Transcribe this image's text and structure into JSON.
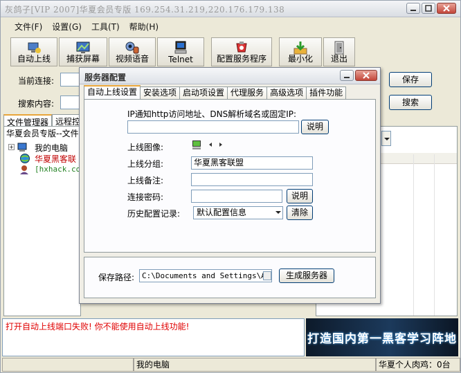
{
  "window": {
    "title": "灰鸽子[VIP 2007]华夏会员专版  169.254.31.219,220.176.179.138"
  },
  "menu": [
    "文件(F)",
    "设置(G)",
    "工具(T)",
    "帮助(H)"
  ],
  "toolbar": {
    "buttons": [
      "自动上线",
      "捕获屏幕",
      "视频语音",
      "Telnet",
      "配置服务程序",
      "最小化",
      "退出"
    ]
  },
  "connection": {
    "current_label": "当前连接:",
    "search_label": "搜索内容:",
    "save_button": "保存",
    "search_button": "搜索"
  },
  "main_tabs": [
    "文件管理器",
    "远程控"
  ],
  "tree": {
    "header": "华夏会员专版--文件",
    "items": [
      "我的电脑",
      "华夏黑客联",
      "[hxhack.com"
    ]
  },
  "log_message": "打开自动上线端口失败! 你不能使用自动上线功能!",
  "banner": {
    "text": "打造国内第一黑客学习阵地"
  },
  "status": {
    "left": "我的电脑",
    "right": "华夏个人肉鸡：0台"
  },
  "dialog": {
    "title": "服务器配置",
    "tabs": [
      "自动上线设置",
      "安装选项",
      "启动项设置",
      "代理服务",
      "高级选项",
      "插件功能"
    ],
    "ip_label": "IP通知http访问地址、DNS解析域名或固定IP:",
    "ip_value": "",
    "explain": "说明",
    "image_label": "上线图像:",
    "group_label": "上线分组:",
    "group_value": "华夏黑客联盟",
    "note_label": "上线备注:",
    "note_value": "",
    "password_label": "连接密码:",
    "password_value": "",
    "history_label": "历史配置记录:",
    "history_value": "默认配置信息",
    "clear_button": "清除",
    "save_path_label": "保存路径:",
    "save_path_value": "C:\\Documents and Settings\\Adm",
    "generate_button": "生成服务器"
  },
  "colors": {
    "log_text": "#e00000",
    "tab_highlight": "#e8a53a"
  }
}
